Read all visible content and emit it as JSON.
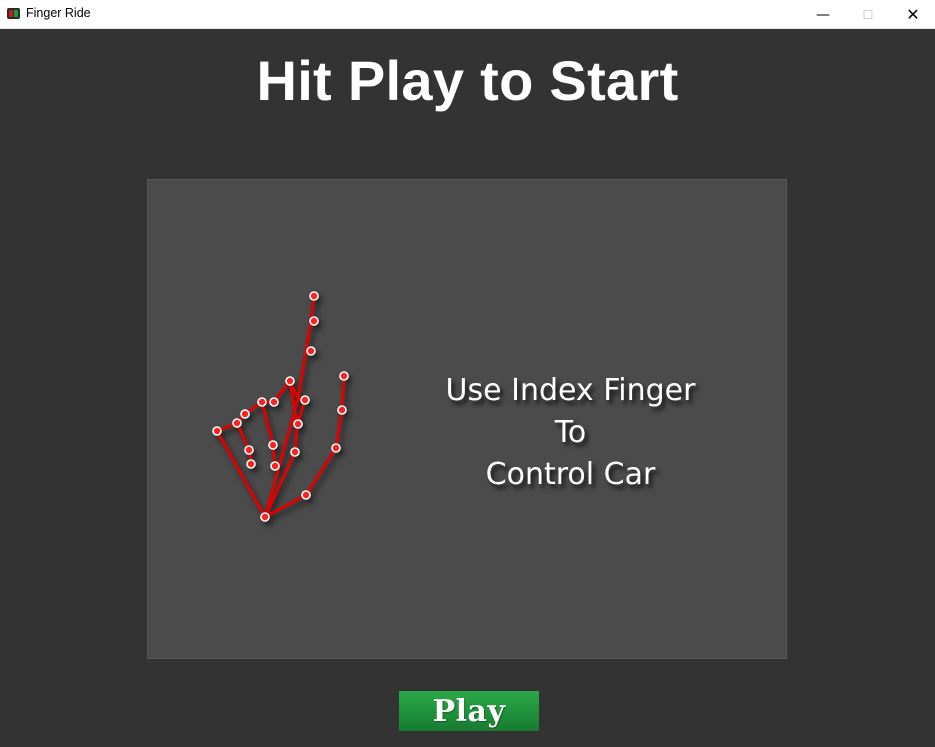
{
  "window": {
    "title": "Finger Ride",
    "icon": "app-icon",
    "controls": {
      "minimize": "—",
      "maximize": "☐",
      "close": "✕"
    }
  },
  "heading": "Hit Play to Start",
  "instruction": {
    "line1": "Use Index Finger",
    "line2": "To",
    "line3": "Control Car"
  },
  "hand_illustration": {
    "icon": "hand-landmarks-icon",
    "line_color": "#e00000",
    "point_color": "#ff2020"
  },
  "play_button": {
    "label": "Play",
    "color": "#1f8f3a"
  },
  "colors": {
    "background": "#333333",
    "panel": "#4b4b4b",
    "text": "#ffffff"
  }
}
